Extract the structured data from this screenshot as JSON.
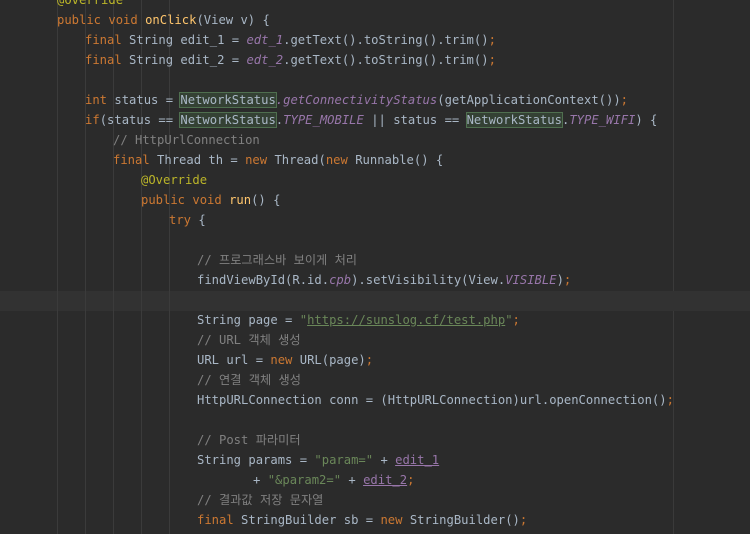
{
  "editor": {
    "lines": [
      {
        "indent": 2,
        "tokens": [
          {
            "t": "@Override",
            "c": "ann"
          }
        ]
      },
      {
        "indent": 2,
        "tokens": [
          {
            "t": "public void ",
            "c": "kw"
          },
          {
            "t": "onClick",
            "c": "fn"
          },
          {
            "t": "(View v) {"
          }
        ]
      },
      {
        "indent": 3,
        "tokens": [
          {
            "t": "final ",
            "c": "kw"
          },
          {
            "t": "String edit_1 = "
          },
          {
            "t": "edt_1",
            "c": "ital"
          },
          {
            "t": ".getText().toString().trim()"
          },
          {
            "t": ";",
            "c": "kw"
          }
        ]
      },
      {
        "indent": 3,
        "tokens": [
          {
            "t": "final ",
            "c": "kw"
          },
          {
            "t": "String edit_2 = "
          },
          {
            "t": "edt_2",
            "c": "ital"
          },
          {
            "t": ".getText().toString().trim()"
          },
          {
            "t": ";",
            "c": "kw"
          }
        ]
      },
      {
        "indent": 0,
        "tokens": []
      },
      {
        "indent": 3,
        "tokens": [
          {
            "t": "int ",
            "c": "kw"
          },
          {
            "t": "status = "
          },
          {
            "t": "NetworkStatus",
            "c": "hl"
          },
          {
            "t": ".getConnectivityStatus",
            "c": "ital"
          },
          {
            "t": "(getApplicationContext())"
          },
          {
            "t": ";",
            "c": "kw"
          }
        ]
      },
      {
        "indent": 3,
        "tokens": [
          {
            "t": "if",
            "c": "kw"
          },
          {
            "t": "(status == "
          },
          {
            "t": "NetworkStatus",
            "c": "hl"
          },
          {
            "t": "."
          },
          {
            "t": "TYPE_MOBILE",
            "c": "ital"
          },
          {
            "t": " || status == "
          },
          {
            "t": "NetworkStatus",
            "c": "hl"
          },
          {
            "t": "."
          },
          {
            "t": "TYPE_WIFI",
            "c": "ital"
          },
          {
            "t": ") {"
          }
        ]
      },
      {
        "indent": 4,
        "tokens": [
          {
            "t": "// HttpUrlConnection",
            "c": "cmt"
          }
        ]
      },
      {
        "indent": 4,
        "tokens": [
          {
            "t": "final ",
            "c": "kw"
          },
          {
            "t": "Thread th = "
          },
          {
            "t": "new ",
            "c": "kw"
          },
          {
            "t": "Thread("
          },
          {
            "t": "new ",
            "c": "kw"
          },
          {
            "t": "Runnable() {"
          }
        ]
      },
      {
        "indent": 5,
        "tokens": [
          {
            "t": "@Override",
            "c": "ann"
          }
        ]
      },
      {
        "indent": 5,
        "tokens": [
          {
            "t": "public void ",
            "c": "kw"
          },
          {
            "t": "run",
            "c": "fn"
          },
          {
            "t": "() {"
          }
        ]
      },
      {
        "indent": 6,
        "tokens": [
          {
            "t": "try ",
            "c": "kw"
          },
          {
            "t": "{"
          }
        ]
      },
      {
        "indent": 0,
        "tokens": []
      },
      {
        "indent": 7,
        "tokens": [
          {
            "t": "// 프로그래스바 보이게 처리",
            "c": "cmt"
          }
        ]
      },
      {
        "indent": 7,
        "tokens": [
          {
            "t": "findViewById(R.id."
          },
          {
            "t": "cpb",
            "c": "ital"
          },
          {
            "t": ").setVisibility(View."
          },
          {
            "t": "VISIBLE",
            "c": "ital"
          },
          {
            "t": ")"
          },
          {
            "t": ";",
            "c": "kw"
          }
        ]
      },
      {
        "indent": 0,
        "tokens": []
      },
      {
        "indent": 7,
        "tokens": [
          {
            "t": "String page = "
          },
          {
            "t": "\"",
            "c": "str"
          },
          {
            "t": "https://sunslog.cf/test.php",
            "c": "url"
          },
          {
            "t": "\"",
            "c": "str"
          },
          {
            "t": ";",
            "c": "kw"
          }
        ]
      },
      {
        "indent": 7,
        "tokens": [
          {
            "t": "// URL 객체 생성",
            "c": "cmt"
          }
        ]
      },
      {
        "indent": 7,
        "tokens": [
          {
            "t": "URL url = "
          },
          {
            "t": "new ",
            "c": "kw"
          },
          {
            "t": "URL(page)"
          },
          {
            "t": ";",
            "c": "kw"
          }
        ]
      },
      {
        "indent": 7,
        "tokens": [
          {
            "t": "// 연결 객체 생성",
            "c": "cmt"
          }
        ]
      },
      {
        "indent": 7,
        "tokens": [
          {
            "t": "HttpURLConnection conn = (HttpURLConnection)url.openConnection()"
          },
          {
            "t": ";",
            "c": "kw"
          }
        ]
      },
      {
        "indent": 0,
        "tokens": []
      },
      {
        "indent": 7,
        "tokens": [
          {
            "t": "// Post 파라미터",
            "c": "cmt"
          }
        ]
      },
      {
        "indent": 7,
        "tokens": [
          {
            "t": "String params = "
          },
          {
            "t": "\"param=\"",
            "c": "str"
          },
          {
            "t": " + "
          },
          {
            "t": "edit_1",
            "c": "fld"
          }
        ]
      },
      {
        "indent": 9,
        "tokens": [
          {
            "t": "+ "
          },
          {
            "t": "\"&param2=\"",
            "c": "str"
          },
          {
            "t": " + "
          },
          {
            "t": "edit_2",
            "c": "fld"
          },
          {
            "t": ";",
            "c": "kw"
          }
        ]
      },
      {
        "indent": 7,
        "tokens": [
          {
            "t": "// 결과값 저장 문자열",
            "c": "cmt"
          }
        ]
      },
      {
        "indent": 7,
        "tokens": [
          {
            "t": "final ",
            "c": "kw"
          },
          {
            "t": "StringBuilder sb = "
          },
          {
            "t": "new ",
            "c": "kw"
          },
          {
            "t": "StringBuilder()"
          },
          {
            "t": ";",
            "c": "kw"
          }
        ]
      }
    ]
  }
}
